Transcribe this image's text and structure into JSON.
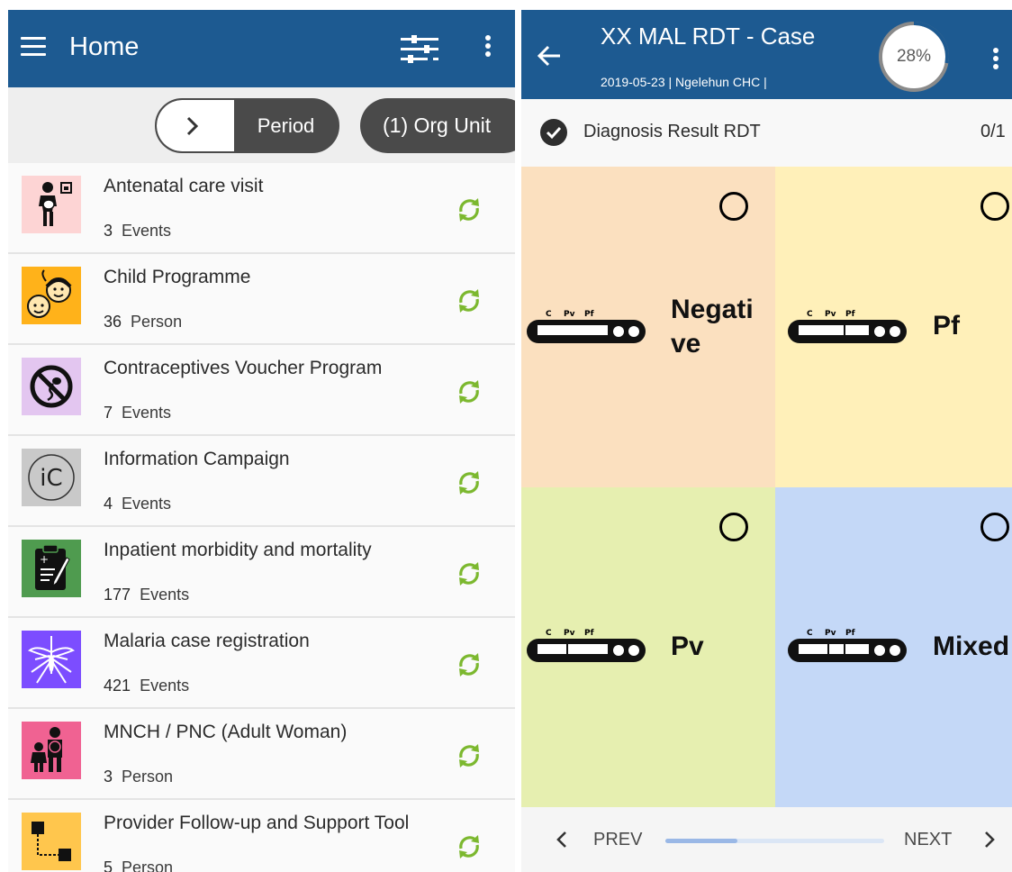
{
  "left": {
    "app_title": "Home",
    "chips": {
      "period": "Period",
      "org_unit": "(1) Org Unit"
    },
    "programs": [
      {
        "name": "Antenatal care visit",
        "count": "3",
        "unit": "Events",
        "icon": "pregnant-woman-icon",
        "icon_bg": "#fdd4d4"
      },
      {
        "name": "Child Programme",
        "count": "36",
        "unit": "Person",
        "icon": "children-icon",
        "icon_bg": "#ffb21a"
      },
      {
        "name": "Contraceptives Voucher Program",
        "count": "7",
        "unit": "Events",
        "icon": "no-sperm-icon",
        "icon_bg": "#e3c6f0"
      },
      {
        "name": "Information Campaign",
        "count": "4",
        "unit": "Events",
        "icon": "info-campaign-icon",
        "icon_bg": "#c9c9c9"
      },
      {
        "name": "Inpatient morbidity and mortality",
        "count": "177",
        "unit": "Events",
        "icon": "clipboard-icon",
        "icon_bg": "#4f9b4f"
      },
      {
        "name": "Malaria case registration",
        "count": "421",
        "unit": "Events",
        "icon": "mosquito-icon",
        "icon_bg": "#7c4dff"
      },
      {
        "name": "MNCH / PNC (Adult Woman)",
        "count": "3",
        "unit": "Person",
        "icon": "family-icon",
        "icon_bg": "#f06292"
      },
      {
        "name": "Provider Follow-up and Support Tool",
        "count": "5",
        "unit": "Person",
        "icon": "flow-icon",
        "icon_bg": "#ffc64d"
      }
    ],
    "colors": {
      "appbar": "#1d5a91",
      "sync": "#7cb82f"
    }
  },
  "right": {
    "title": "XX MAL RDT - Case",
    "subtitle": "2019-05-23 | Ngelehun CHC |",
    "progress_text": "28%",
    "progress_value": 0.28,
    "section_label": "Diagnosis Result RDT",
    "section_count": "0/1",
    "strip_labels": {
      "c": "C",
      "pv": "Pv",
      "pf": "Pf"
    },
    "options": [
      {
        "label": "Negati\nve",
        "color": "#fbe0bf"
      },
      {
        "label": "Pf",
        "color": "#fff0b9"
      },
      {
        "label": "Pv",
        "color": "#e6efb0"
      },
      {
        "label": "Mixed",
        "color": "#c4d8f7"
      }
    ],
    "nav": {
      "prev": "PREV",
      "next": "NEXT",
      "progress_fraction": 0.33
    }
  }
}
